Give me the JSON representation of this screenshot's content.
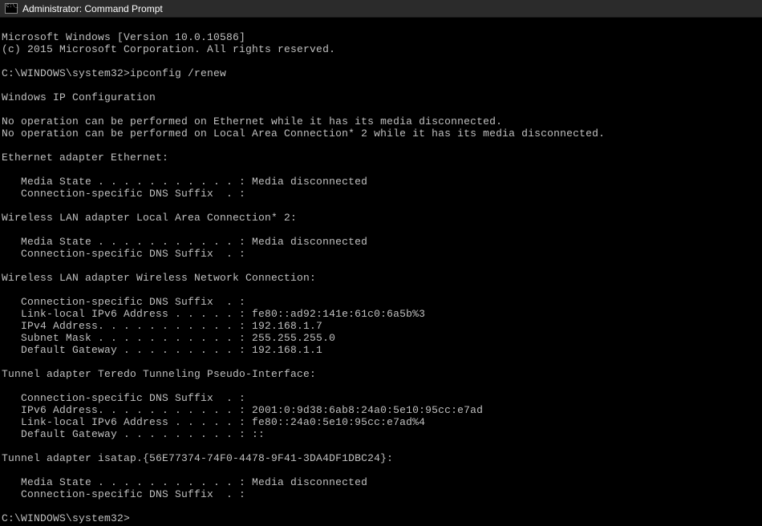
{
  "window": {
    "title": "Administrator: Command Prompt"
  },
  "lines": {
    "l0": "Microsoft Windows [Version 10.0.10586]",
    "l1": "(c) 2015 Microsoft Corporation. All rights reserved.",
    "l2": "",
    "l3": "C:\\WINDOWS\\system32>ipconfig /renew",
    "l4": "",
    "l5": "Windows IP Configuration",
    "l6": "",
    "l7": "No operation can be performed on Ethernet while it has its media disconnected.",
    "l8": "No operation can be performed on Local Area Connection* 2 while it has its media disconnected.",
    "l9": "",
    "l10": "Ethernet adapter Ethernet:",
    "l11": "",
    "l12": "   Media State . . . . . . . . . . . : Media disconnected",
    "l13": "   Connection-specific DNS Suffix  . :",
    "l14": "",
    "l15": "Wireless LAN adapter Local Area Connection* 2:",
    "l16": "",
    "l17": "   Media State . . . . . . . . . . . : Media disconnected",
    "l18": "   Connection-specific DNS Suffix  . :",
    "l19": "",
    "l20": "Wireless LAN adapter Wireless Network Connection:",
    "l21": "",
    "l22": "   Connection-specific DNS Suffix  . :",
    "l23": "   Link-local IPv6 Address . . . . . : fe80::ad92:141e:61c0:6a5b%3",
    "l24": "   IPv4 Address. . . . . . . . . . . : 192.168.1.7",
    "l25": "   Subnet Mask . . . . . . . . . . . : 255.255.255.0",
    "l26": "   Default Gateway . . . . . . . . . : 192.168.1.1",
    "l27": "",
    "l28": "Tunnel adapter Teredo Tunneling Pseudo-Interface:",
    "l29": "",
    "l30": "   Connection-specific DNS Suffix  . :",
    "l31": "   IPv6 Address. . . . . . . . . . . : 2001:0:9d38:6ab8:24a0:5e10:95cc:e7ad",
    "l32": "   Link-local IPv6 Address . . . . . : fe80::24a0:5e10:95cc:e7ad%4",
    "l33": "   Default Gateway . . . . . . . . . : ::",
    "l34": "",
    "l35": "Tunnel adapter isatap.{56E77374-74F0-4478-9F41-3DA4DF1DBC24}:",
    "l36": "",
    "l37": "   Media State . . . . . . . . . . . : Media disconnected",
    "l38": "   Connection-specific DNS Suffix  . :",
    "l39": "",
    "l40": "C:\\WINDOWS\\system32>"
  }
}
